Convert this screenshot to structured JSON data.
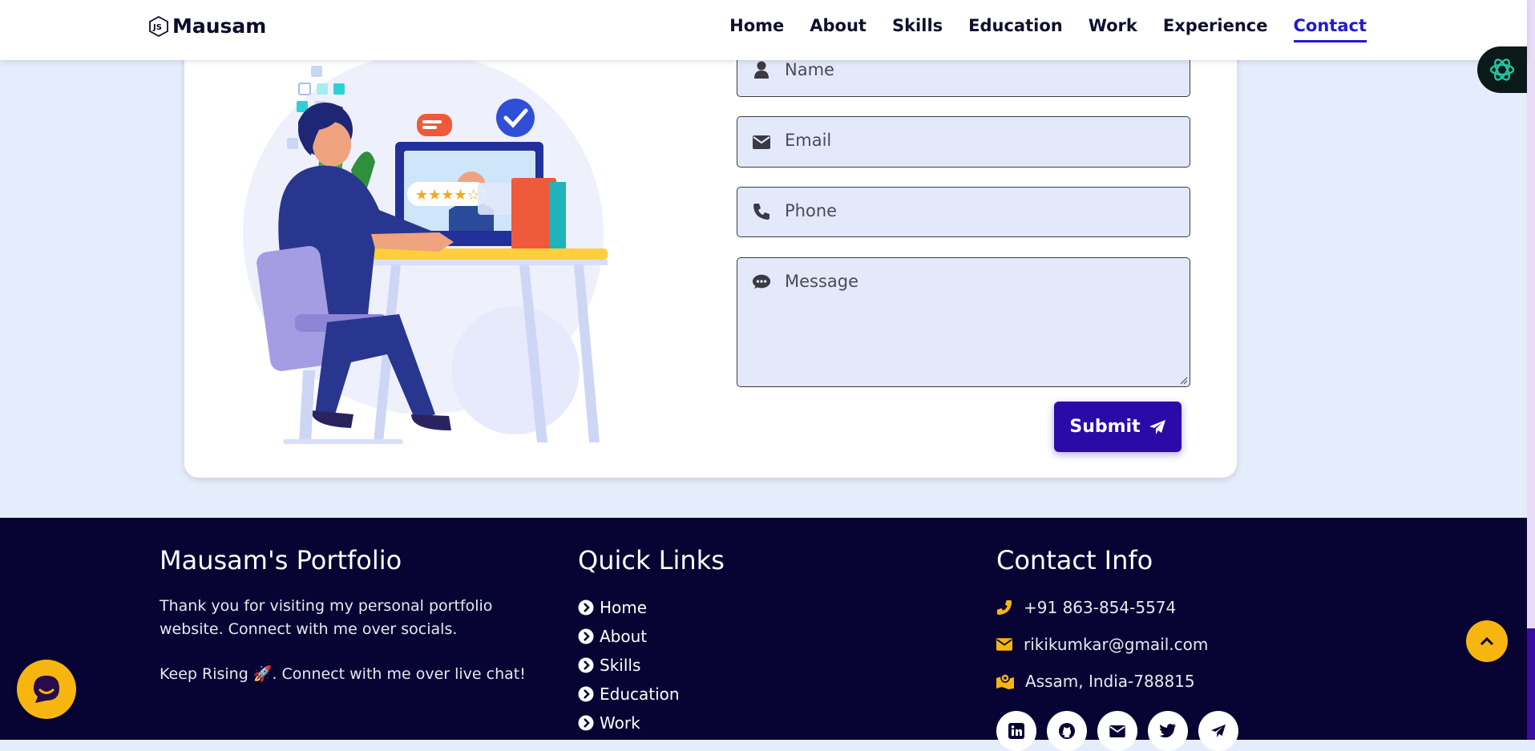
{
  "brand": {
    "name": "Mausam",
    "logo_icon": "nodejs-logo-icon"
  },
  "nav": {
    "items": [
      "Home",
      "About",
      "Skills",
      "Education",
      "Work",
      "Experience",
      "Contact"
    ],
    "active": "Contact"
  },
  "form": {
    "name_placeholder": "Name",
    "email_placeholder": "Email",
    "phone_placeholder": "Phone",
    "message_placeholder": "Message",
    "submit_label": "Submit"
  },
  "footer": {
    "about": {
      "title": "Mausam's Portfolio",
      "text": "Thank you for visiting my personal portfolio website. Connect with me over socials.",
      "text2": "Keep Rising 🚀. Connect with me over live chat!"
    },
    "quick_links": {
      "title": "Quick Links",
      "items": [
        "Home",
        "About",
        "Skills",
        "Education",
        "Work"
      ]
    },
    "contact": {
      "title": "Contact Info",
      "phone": "+91 863-854-5574",
      "email": "rikikumkar@gmail.com",
      "address": "Assam, India-788815"
    },
    "socials": [
      "linkedin-icon",
      "github-icon",
      "mail-icon",
      "twitter-icon",
      "telegram-icon"
    ]
  },
  "colors": {
    "accent": "#2319d1",
    "footer_bg": "#070433",
    "yellow": "#f7b510",
    "submit_bg": "#2a0ba8",
    "page_bg": "#e5ecfb"
  }
}
